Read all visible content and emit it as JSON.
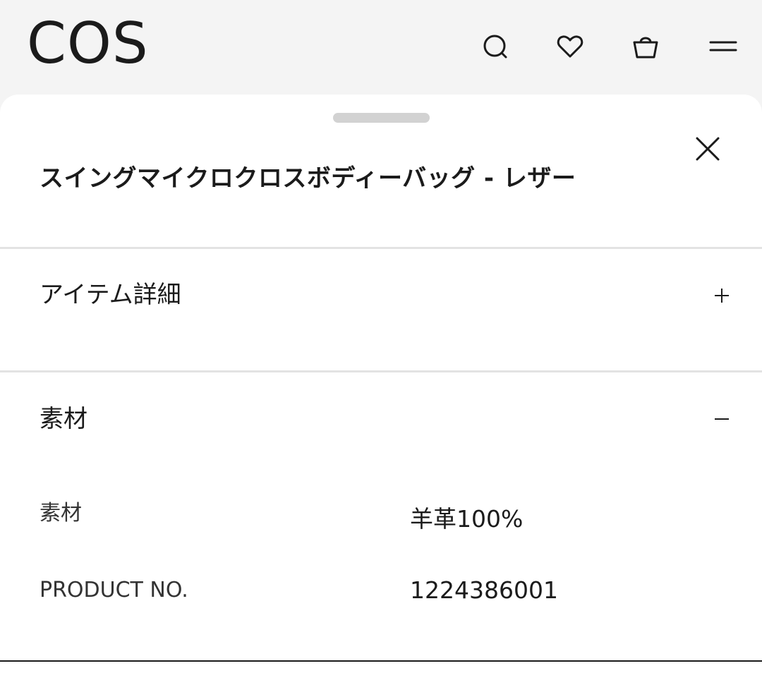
{
  "header": {
    "logo": "COS",
    "icons": [
      "search-icon",
      "heart-icon",
      "bag-icon",
      "menu-icon"
    ]
  },
  "sheet": {
    "title": "スイングマイクロクロスボディーバッグ - レザー"
  },
  "accordion": [
    {
      "label": "アイテム詳細",
      "toggle": "+",
      "expanded": false
    },
    {
      "label": "素材",
      "toggle": "−",
      "expanded": true
    }
  ],
  "material": {
    "rows": [
      {
        "key": "素材",
        "value": "羊革100%"
      },
      {
        "key": "PRODUCT NO.",
        "value": "1224386001"
      }
    ]
  },
  "colors": {
    "text": "#1b1b1b",
    "background": "#f4f4f4",
    "sheet": "#ffffff",
    "divider": "#e3e3e3"
  }
}
